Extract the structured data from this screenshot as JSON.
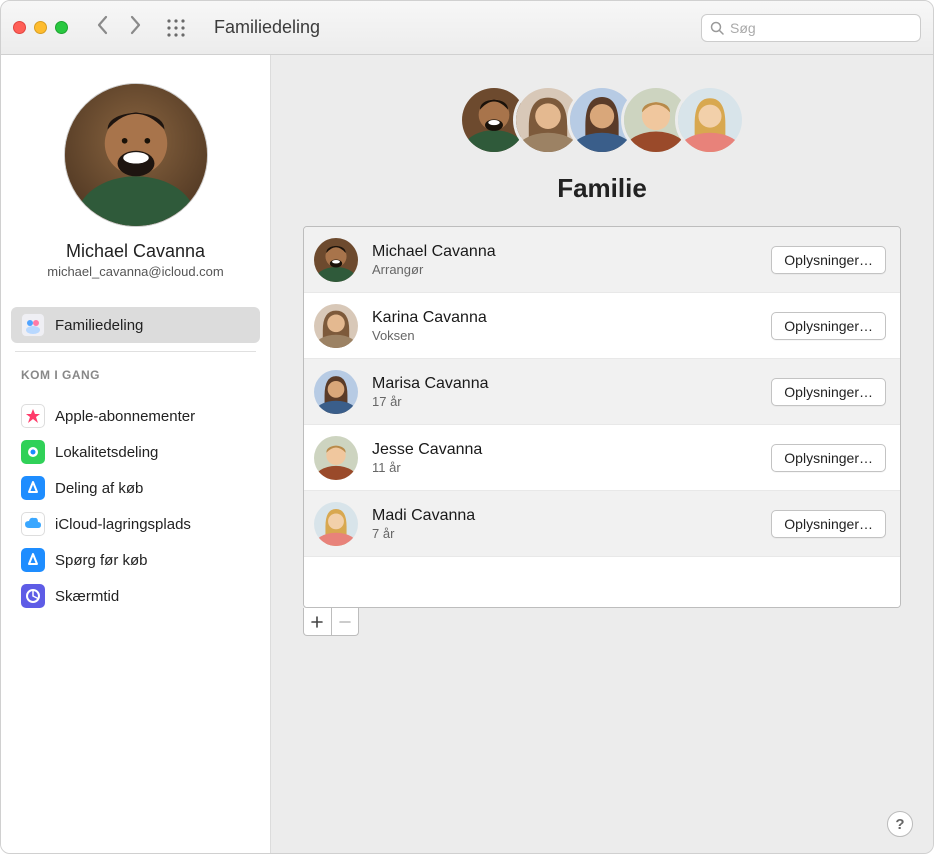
{
  "window": {
    "title": "Familiedeling",
    "search_placeholder": "Søg"
  },
  "profile": {
    "name": "Michael Cavanna",
    "email": "michael_cavanna@icloud.com"
  },
  "sidebar": {
    "items": [
      {
        "label": "Familiedeling",
        "selected": true,
        "icon": "family-icon",
        "color": "#efeff4"
      }
    ],
    "section_label": "KOM I GANG",
    "kom_items": [
      {
        "label": "Apple-abonnementer",
        "icon": "subscriptions-icon",
        "color": "#ffffff"
      },
      {
        "label": "Lokalitetsdeling",
        "icon": "findmy-icon",
        "color": "#30d158"
      },
      {
        "label": "Deling af køb",
        "icon": "appstore-icon",
        "color": "#1e8dff"
      },
      {
        "label": "iCloud-lagringsplads",
        "icon": "icloud-icon",
        "color": "#ffffff"
      },
      {
        "label": "Spørg før køb",
        "icon": "ask-icon",
        "color": "#1e8dff"
      },
      {
        "label": "Skærmtid",
        "icon": "screentime-icon",
        "color": "#5e5ce6"
      }
    ]
  },
  "main": {
    "heading": "Familie",
    "details_button": "Oplysninger…",
    "members": [
      {
        "name": "Michael Cavanna",
        "subtitle": "Arrangør"
      },
      {
        "name": "Karina Cavanna",
        "subtitle": "Voksen"
      },
      {
        "name": "Marisa Cavanna",
        "subtitle": "17 år"
      },
      {
        "name": "Jesse Cavanna",
        "subtitle": "11 år"
      },
      {
        "name": "Madi Cavanna",
        "subtitle": "7 år"
      }
    ]
  },
  "avatar_colors": {
    "michael": {
      "bg": "#6d4a2e",
      "shirt": "#2f5a3a",
      "skin": "#a8744b"
    },
    "karina": {
      "bg": "#d8c8b8",
      "shirt": "#9c8264",
      "skin": "#e4b990",
      "hair": "#7d5a3b"
    },
    "marisa": {
      "bg": "#b7cbe4",
      "shirt": "#3a5e8a",
      "skin": "#d9a77a",
      "hair": "#5a3b28"
    },
    "jesse": {
      "bg": "#cdd4c0",
      "shirt": "#9a4a2a",
      "skin": "#f0c79e",
      "hair": "#b88a4a"
    },
    "madi": {
      "bg": "#d8e4ea",
      "shirt": "#e8827a",
      "skin": "#f2d0aa",
      "hair": "#d8a850"
    }
  }
}
